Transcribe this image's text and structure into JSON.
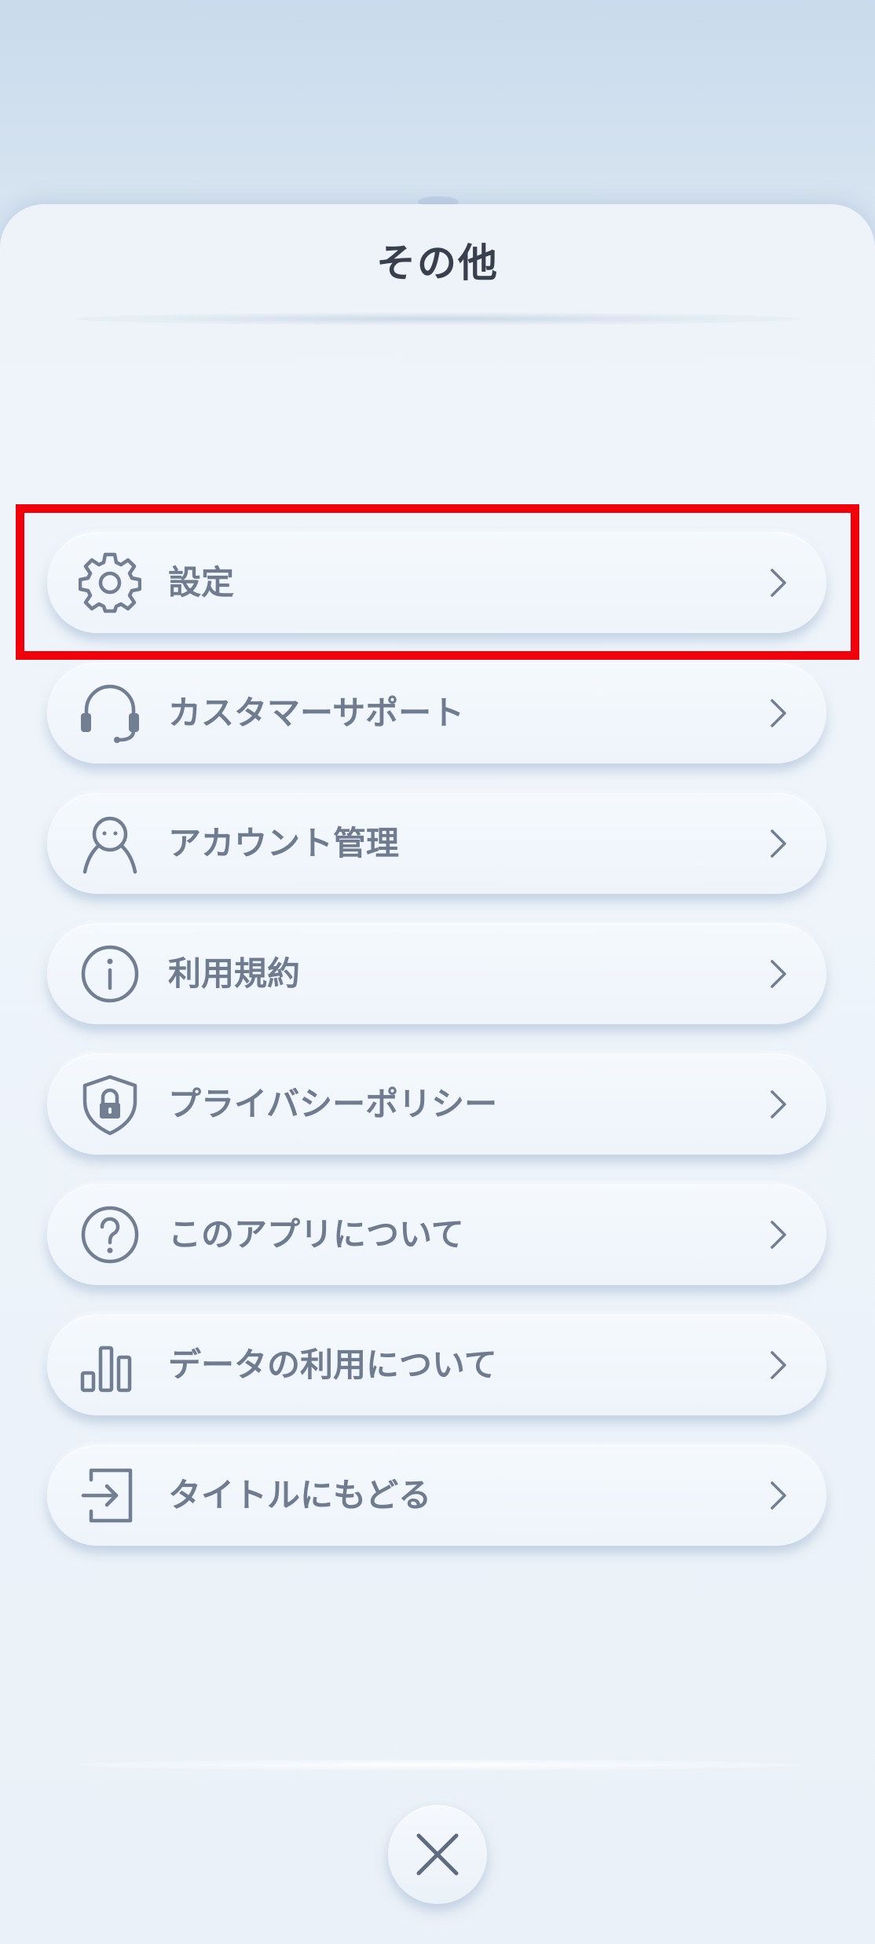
{
  "sheet": {
    "title": "その他"
  },
  "menu": {
    "items": [
      {
        "label": "設定",
        "icon": "gear-icon"
      },
      {
        "label": "カスタマーサポート",
        "icon": "headset-icon"
      },
      {
        "label": "アカウント管理",
        "icon": "user-icon"
      },
      {
        "label": "利用規約",
        "icon": "info-icon"
      },
      {
        "label": "プライバシーポリシー",
        "icon": "shield-lock-icon"
      },
      {
        "label": "このアプリについて",
        "icon": "question-icon"
      },
      {
        "label": "データの利用について",
        "icon": "bar-chart-icon"
      },
      {
        "label": "タイトルにもどる",
        "icon": "exit-icon"
      }
    ]
  },
  "close_button": {
    "icon": "close-icon"
  },
  "colors": {
    "highlight": "#f0000a",
    "icon_stroke": "#727e92",
    "label_text": "#6f7b8f",
    "title_text": "#39404d"
  }
}
